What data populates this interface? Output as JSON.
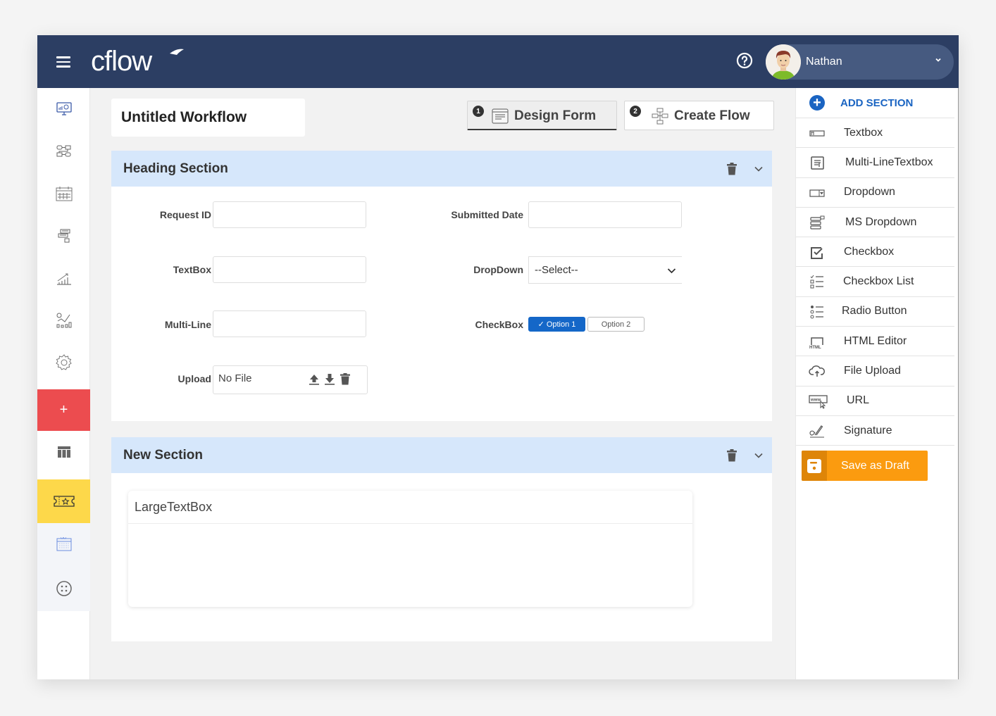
{
  "app": {
    "brand": "cflow",
    "colors": {
      "topbar": "#2c3e63",
      "accent_blue": "#1a64c2",
      "add_red": "#ec4c4f",
      "ticket_yellow": "#fdd84a",
      "save_orange": "#fb9b0f",
      "section_header": "#d6e7fb"
    }
  },
  "header": {
    "menu_icon": "hamburger-icon",
    "help_icon": "question-circle-icon",
    "user": {
      "name": "Nathan",
      "avatar": "user-avatar",
      "caret_icon": "chevron-down-icon"
    }
  },
  "sidebar": {
    "items": [
      {
        "name": "dashboard",
        "icon": "monitor-chart-icon"
      },
      {
        "name": "workflows",
        "icon": "flow-diagram-icon"
      },
      {
        "name": "calendar",
        "icon": "calendar-icon"
      },
      {
        "name": "requests",
        "icon": "stacked-forms-icon"
      },
      {
        "name": "analytics",
        "icon": "growth-chart-icon"
      },
      {
        "name": "reports",
        "icon": "report-chart-icon"
      },
      {
        "name": "settings",
        "icon": "gear-icon"
      },
      {
        "name": "create",
        "icon": "plus-icon",
        "label": "+"
      },
      {
        "name": "table",
        "icon": "table-icon"
      },
      {
        "name": "tickets",
        "icon": "ticket-star-icon"
      },
      {
        "name": "schedule",
        "icon": "calendar-grid-icon"
      },
      {
        "name": "support",
        "icon": "lifebuoy-icon"
      }
    ]
  },
  "workflow": {
    "title": "Untitled Workflow",
    "steps": [
      {
        "number": "1",
        "label": "Design Form",
        "icon": "form-icon",
        "active": true
      },
      {
        "number": "2",
        "label": "Create Flow",
        "icon": "flowchart-icon",
        "active": false
      }
    ]
  },
  "sections": [
    {
      "title": "Heading Section",
      "fields": {
        "request_id": {
          "label": "Request ID",
          "value": ""
        },
        "submitted_date": {
          "label": "Submitted Date",
          "value": ""
        },
        "textbox": {
          "label": "TextBox",
          "value": ""
        },
        "dropdown": {
          "label": "DropDown",
          "selected": "--Select--"
        },
        "multiline": {
          "label": "Multi-Line",
          "value": ""
        },
        "checkbox": {
          "label": "CheckBox",
          "options": [
            {
              "label": "Option 1",
              "checked": true,
              "check_glyph": "✓"
            },
            {
              "label": "Option 2",
              "checked": false
            }
          ]
        },
        "upload": {
          "label": "Upload",
          "value": "No File"
        }
      }
    },
    {
      "title": "New Section",
      "large_textbox": {
        "label": "LargeTextBox",
        "value": ""
      }
    }
  ],
  "toolbox": {
    "add_section": "ADD SECTION",
    "items": [
      {
        "label": "Textbox",
        "icon": "textbox-icon"
      },
      {
        "label": "Multi-LineTextbox",
        "icon": "multiline-textbox-icon"
      },
      {
        "label": "Dropdown",
        "icon": "dropdown-icon"
      },
      {
        "label": "MS Dropdown",
        "icon": "multiselect-dropdown-icon"
      },
      {
        "label": "Checkbox",
        "icon": "checkbox-icon"
      },
      {
        "label": "Checkbox List",
        "icon": "checkbox-list-icon"
      },
      {
        "label": "Radio Button",
        "icon": "radio-list-icon"
      },
      {
        "label": "HTML Editor",
        "icon": "html-editor-icon"
      },
      {
        "label": "File Upload",
        "icon": "cloud-upload-icon"
      },
      {
        "label": "URL",
        "icon": "url-icon"
      },
      {
        "label": "Signature",
        "icon": "signature-icon"
      }
    ],
    "save_draft": "Save as Draft"
  }
}
